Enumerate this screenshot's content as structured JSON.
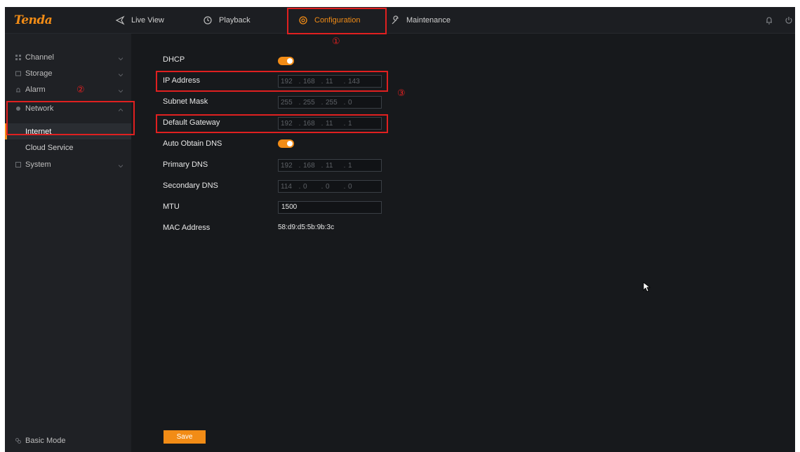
{
  "brand": {
    "logo": "Tenda",
    "accent": "#f28c16"
  },
  "nav": {
    "live_view": "Live View",
    "playback": "Playback",
    "configuration": "Configuration",
    "maintenance": "Maintenance"
  },
  "sidebar": {
    "channel": "Channel",
    "storage": "Storage",
    "alarm": "Alarm",
    "network": "Network",
    "internet": "Internet",
    "cloud_service": "Cloud Service",
    "system": "System",
    "basic_mode": "Basic Mode"
  },
  "form": {
    "dhcp": {
      "label": "DHCP",
      "enabled": true
    },
    "ip_address": {
      "label": "IP Address",
      "octets": [
        "192",
        "168",
        "11",
        "143"
      ]
    },
    "subnet_mask": {
      "label": "Subnet Mask",
      "octets": [
        "255",
        "255",
        "255",
        "0"
      ]
    },
    "default_gateway": {
      "label": "Default Gateway",
      "octets": [
        "192",
        "168",
        "11",
        "1"
      ]
    },
    "auto_dns": {
      "label": "Auto Obtain DNS",
      "enabled": true
    },
    "primary_dns": {
      "label": "Primary DNS",
      "octets": [
        "192",
        "168",
        "11",
        "1"
      ]
    },
    "secondary_dns": {
      "label": "Secondary DNS",
      "octets": [
        "114",
        "0",
        "0",
        "0"
      ]
    },
    "mtu": {
      "label": "MTU",
      "value": "1500"
    },
    "mac": {
      "label": "MAC Address",
      "value": "58:d9:d5:5b:9b:3c"
    },
    "save": "Save"
  },
  "annotations": {
    "m1": "①",
    "m2": "②",
    "m3": "③",
    "color": "#e02020"
  }
}
